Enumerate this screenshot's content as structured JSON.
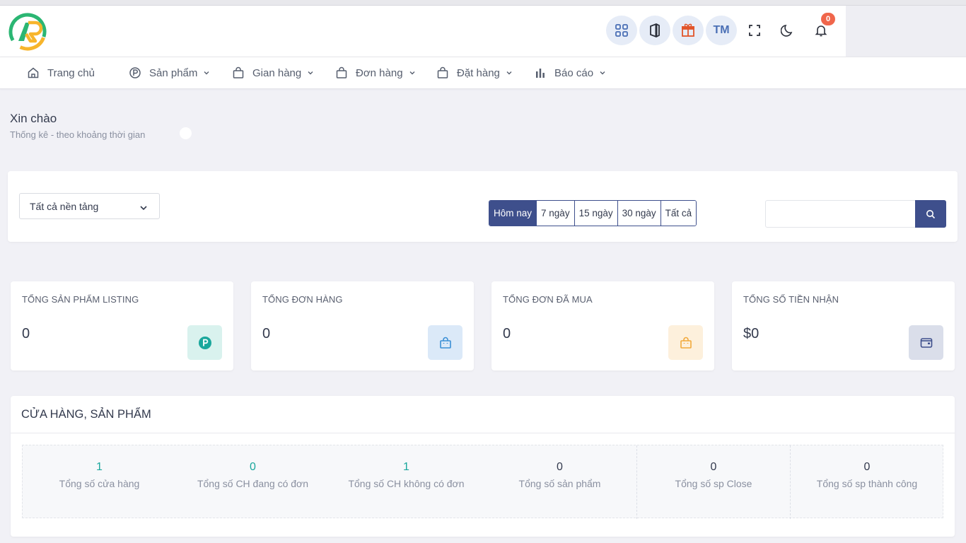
{
  "header": {
    "icons": [
      "apps-grid-icon",
      "office-icon",
      "store-icon",
      "user-initials",
      "fullscreen-icon",
      "moon-icon",
      "bell-icon"
    ],
    "user_initials": "TM",
    "notification_count": "0"
  },
  "nav": {
    "items": [
      {
        "label": "Trang chủ",
        "icon": "home-icon",
        "dropdown": false
      },
      {
        "label": "Sản phẩm",
        "icon": "product-p-icon",
        "dropdown": true
      },
      {
        "label": "Gian hàng",
        "icon": "bag-icon",
        "dropdown": true
      },
      {
        "label": "Đơn hàng",
        "icon": "bag-icon",
        "dropdown": true
      },
      {
        "label": "Đặt hàng",
        "icon": "bag-icon",
        "dropdown": true
      },
      {
        "label": "Báo cáo",
        "icon": "bar-chart-icon",
        "dropdown": true
      }
    ]
  },
  "greeting": {
    "title": "Xin chào",
    "subtitle": "Thống kê - theo khoảng thời gian"
  },
  "filter": {
    "platform_select": "Tất cả nền tảng",
    "tabs": [
      {
        "label": "Hôm nay",
        "active": true
      },
      {
        "label": "7 ngày",
        "active": false
      },
      {
        "label": "15 ngày",
        "active": false
      },
      {
        "label": "30 ngày",
        "active": false
      },
      {
        "label": "Tất cả",
        "active": false
      }
    ],
    "search_value": ""
  },
  "stats": [
    {
      "label": "TỔNG SẢN PHẨM LISTING",
      "value": "0",
      "icon": "product-p-icon",
      "color": "#1aa79c"
    },
    {
      "label": "TỔNG ĐƠN HÀNG",
      "value": "0",
      "icon": "bag-icon",
      "color": "#3b8fd6"
    },
    {
      "label": "TỔNG ĐƠN ĐÃ MUA",
      "value": "0",
      "icon": "bag-icon",
      "color": "#f2a93b"
    },
    {
      "label": "TỔNG SỐ TIỀN NHẬN",
      "value": "$0",
      "icon": "wallet-icon",
      "color": "#3e4f8c"
    }
  ],
  "panel": {
    "title": "CỬA HÀNG, SẢN PHẨM",
    "metrics": [
      {
        "value": "1",
        "label": "Tổng số cửa hàng",
        "highlight": true
      },
      {
        "value": "0",
        "label": "Tổng số CH đang có đơn",
        "highlight": true
      },
      {
        "value": "1",
        "label": "Tổng số CH không có đơn",
        "highlight": true
      },
      {
        "value": "0",
        "label": "Tổng số sản phẩm",
        "highlight": false
      },
      {
        "value": "0",
        "label": "Tổng số sp Close",
        "highlight": false
      },
      {
        "value": "0",
        "label": "Tổng số sp thành công",
        "highlight": false
      }
    ]
  },
  "colors": {
    "primary": "#3e4f8c",
    "teal": "#1aa79c",
    "badge": "#f0664b"
  }
}
